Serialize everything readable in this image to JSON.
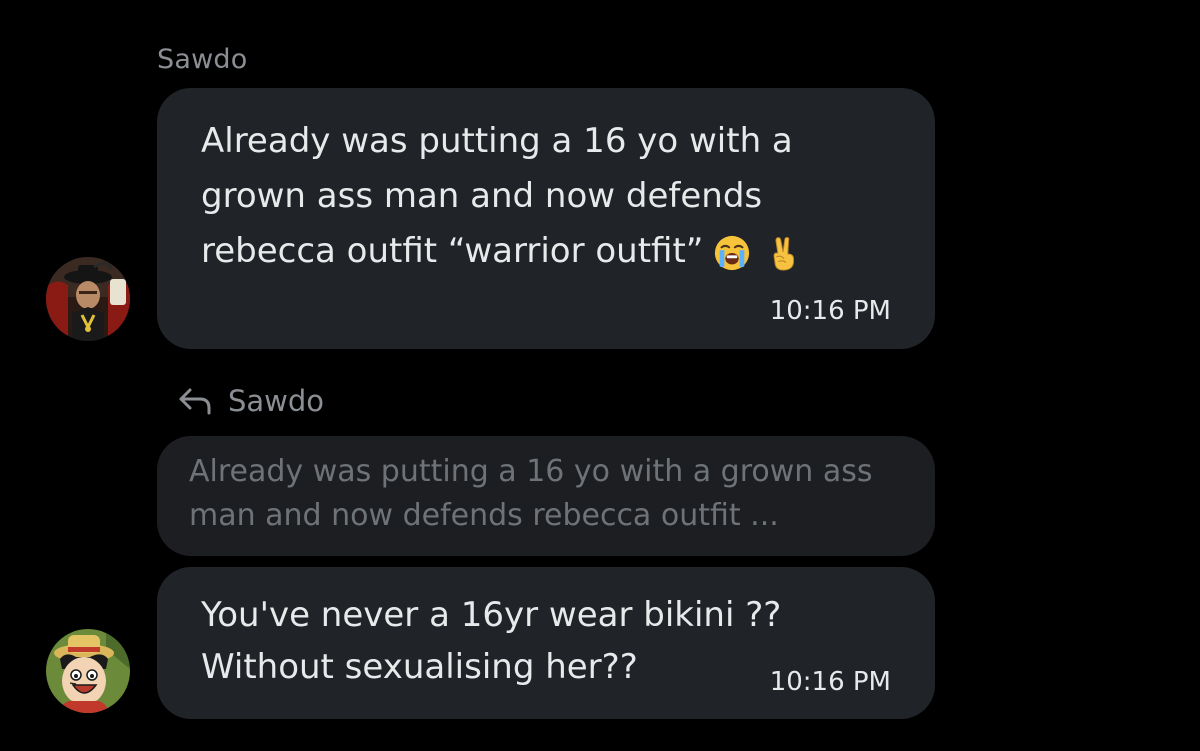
{
  "first_message": {
    "sender": "Sawdo",
    "text": "Already was putting a 16 yo with a\ngrown ass man and now defends\nrebecca outfit “warrior outfit”",
    "emojis": [
      "loudly-crying-face-icon",
      "victory-hand-icon"
    ],
    "time": "10:16 PM"
  },
  "reply": {
    "replying_to": "Sawdo",
    "quoted_text": "Already was putting a 16 yo with a grown ass man and now defends rebecca outfit ...",
    "text": "You've never a 16yr wear bikini ??\nWithout sexualising her??",
    "time": "10:16 PM"
  },
  "colors": {
    "background": "#000000",
    "bubble": "#202327",
    "quote_bubble": "#1c1e21",
    "muted_text": "#8b8f94",
    "primary_text": "#e7e9ea"
  }
}
